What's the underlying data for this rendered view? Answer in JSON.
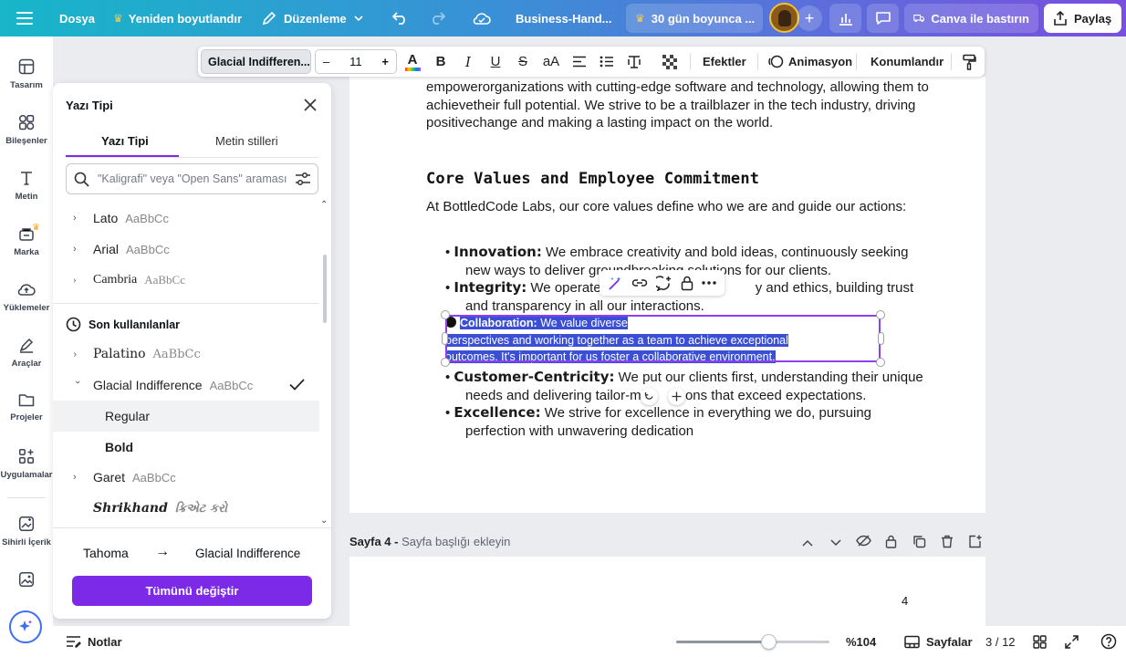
{
  "topbar": {
    "file_label": "Dosya",
    "resize_label": "Yeniden boyutlandır",
    "edit_label": "Düzenleme",
    "doc_title": "Business-Hand...",
    "trial_label": "30 gün boyunca ...",
    "print_label": "Canva ile bastırın",
    "share_label": "Paylaş"
  },
  "format_toolbar": {
    "font_name": "Glacial Indifferen...",
    "font_size": "11",
    "minus": "–",
    "plus": "+",
    "effects_label": "Efektler",
    "animation_label": "Animasyon",
    "position_label": "Konumlandır"
  },
  "rail": {
    "items": [
      "Tasarım",
      "Bileşenler",
      "Metin",
      "Marka",
      "Yüklemeler",
      "Araçlar",
      "Projeler",
      "Uygulamalar",
      "Sihirli İçerik"
    ]
  },
  "font_panel": {
    "title": "Yazı Tipi",
    "tab_fonts": "Yazı Tipi",
    "tab_styles": "Metin stilleri",
    "search_placeholder": "\"Kaligrafi\" veya \"Open Sans\" araması",
    "fonts_top": [
      {
        "name": "Lato",
        "sample": "AaBbCc"
      },
      {
        "name": "Arial",
        "sample": "AaBbCc"
      },
      {
        "name": "Cambria",
        "sample": "AaBbCc"
      }
    ],
    "recent_heading": "Son kullanılanlar",
    "recent": [
      {
        "name": "Palatino",
        "sample": "AaBbCc"
      },
      {
        "name": "Glacial Indifference",
        "sample": "AaBbCc"
      }
    ],
    "variants": [
      "Regular",
      "Bold"
    ],
    "more": [
      {
        "name": "Garet",
        "sample": "AaBbCc"
      },
      {
        "name": "Shrikhand",
        "sample": "ક્રિએટ કરો"
      }
    ],
    "replace_from": "Tahoma",
    "replace_to": "Glacial Indifference",
    "replace_button": "Tümünü değiştir"
  },
  "document": {
    "intro_lines": [
      "empowerorganizations with cutting-edge software and technology, allowing them to",
      "achievetheir full potential. We strive to be a trailblazer in the tech industry, driving",
      "positivechange and making a lasting impact on the world."
    ],
    "heading": "Core Values and Employee Commitment",
    "lead": "At BottledCode Labs, our core values define who we are and guide our actions:",
    "innovation_term": "Innovation:",
    "innovation_l1": " We embrace creativity and bold ideas, continuously seeking",
    "innovation_l2": "new ways to deliver groundbreaking solutions for our clients.",
    "integrity_term": "Integrity:",
    "integrity_l1": " We operate w",
    "integrity_l1b": "y and ethics, building trust",
    "integrity_l2": "and transparency in all our interactions.",
    "collab_term": "Collaboration:",
    "collab_l1": " We value diverse",
    "collab_l2": "perspectives and working together as a team to achieve exceptional",
    "collab_l3": "outcomes. It's important for us foster a collaborative environment.",
    "customer_term": "Customer-Centricity:",
    "customer_l1": " We put our clients first, understanding their unique",
    "customer_l2": "needs and delivering tailor-ma",
    "customer_l2b": "ons that exceed expectations.",
    "excellence_term": "Excellence:",
    "excellence_l1": " We strive for excellence in everything we do, pursuing",
    "excellence_l2": "perfection with unwavering dedication"
  },
  "page_strip": {
    "page_label": "Sayfa 4 -",
    "page_placeholder": "Sayfa başlığı ekleyin",
    "page_number": "4"
  },
  "bottombar": {
    "notes_label": "Notlar",
    "zoom": "%104",
    "zoom_fraction": 0.6,
    "pages_label": "Sayfalar",
    "page_count": "3 / 12"
  },
  "colors": {
    "accent": "#7d2ae8",
    "selection": "#3a4fd6",
    "topbar_start": "#17b6c9",
    "topbar_end": "#7a4ee0"
  }
}
